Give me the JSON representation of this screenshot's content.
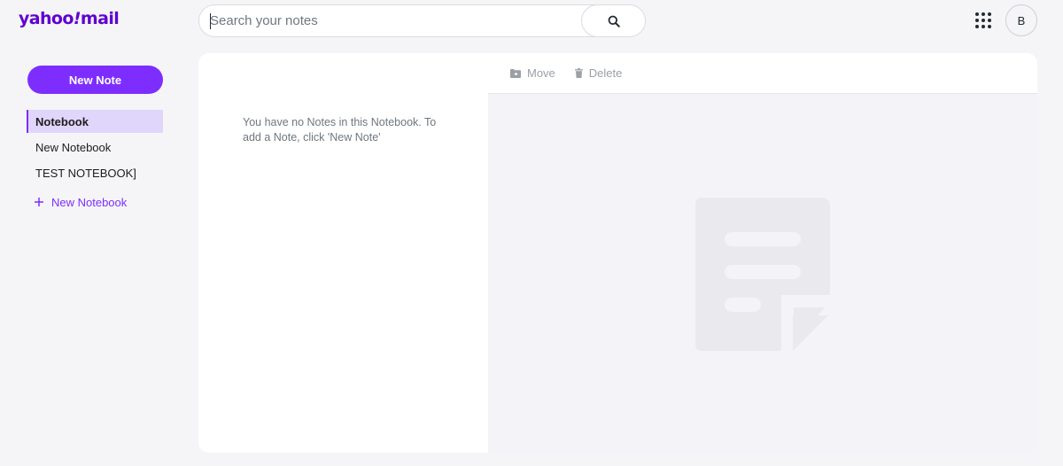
{
  "app": {
    "logo_text_main": "yahoo",
    "logo_bang": "!",
    "logo_text_mail": "mail",
    "brand_color": "#5f01d1",
    "accent_color": "#7d2eff"
  },
  "header": {
    "search_placeholder": "Search your notes",
    "search_icon": "search-icon",
    "apps_icon": "apps-grid-icon",
    "avatar_initial": "B"
  },
  "sidebar": {
    "new_note_label": "New Note",
    "notebooks": [
      {
        "label": "Notebook",
        "active": true
      },
      {
        "label": "New Notebook",
        "active": false
      },
      {
        "label": "TEST NOTEBOOK]",
        "active": false
      }
    ],
    "add_notebook_label": "New Notebook",
    "add_icon": "plus-icon"
  },
  "notes_list": {
    "empty_message": "You have no Notes in this Notebook. To add a Note, click 'New Note'"
  },
  "detail": {
    "toolbar": {
      "move_label": "Move",
      "move_icon": "folder-move-icon",
      "delete_label": "Delete",
      "delete_icon": "trash-icon"
    },
    "placeholder_icon": "note-document-icon"
  }
}
